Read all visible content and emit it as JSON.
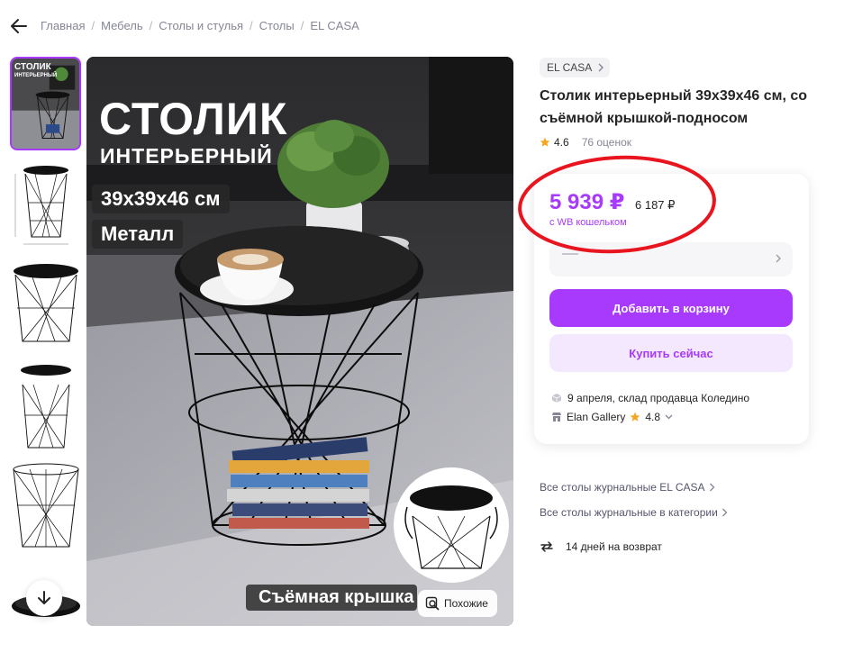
{
  "breadcrumb": {
    "items": [
      "Главная",
      "Мебель",
      "Столы и стулья",
      "Столы",
      "EL CASA"
    ]
  },
  "main_image": {
    "title": "СТОЛИК",
    "subtitle": "ИНТЕРЬЕРНЫЙ",
    "size_label": "39x39x46 см",
    "material_label": "Металл",
    "lid_label": "Съёмная крышка",
    "similar_button": "Похожие"
  },
  "thumbnail": {
    "title": "СТОЛИК",
    "subtitle": "ИНТЕРЬЕРНЫЙ"
  },
  "product": {
    "brand": "EL CASA",
    "title_line1": "Столик интерьерный 39x39x46 см, со",
    "title_line2": "съёмной крышкой-подносом",
    "rating": "4.6",
    "reviews": "76 оценок"
  },
  "price_card": {
    "price": "5 939 ₽",
    "old_price": "6 187 ₽",
    "wallet_note": "с WB кошельком",
    "add_to_cart": "Добавить в корзину",
    "buy_now": "Купить сейчас",
    "delivery": "9 апреля, склад продавца Коледино",
    "seller_name": "Elan Gallery",
    "seller_rating": "4.8"
  },
  "links": {
    "brand_tables": "Все столы журнальные EL CASA",
    "category_tables": "Все столы журнальные в категории"
  },
  "returns": "14 дней на возврат",
  "colors": {
    "accent": "#a73afd",
    "accent_light": "#f4e8ff",
    "annotation_red": "#e8141e",
    "star": "#f5a623"
  }
}
